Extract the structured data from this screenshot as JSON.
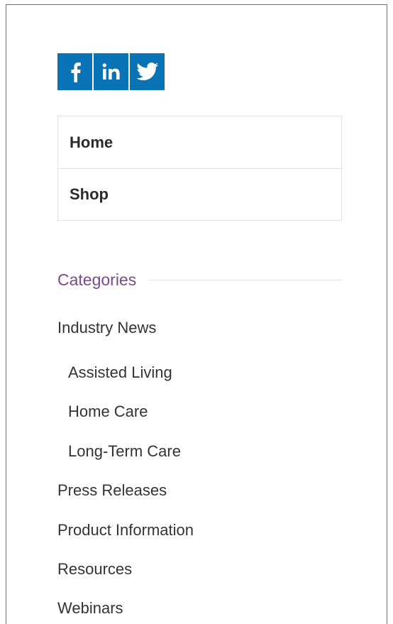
{
  "social": {
    "icons": [
      "facebook-icon",
      "linkedin-icon",
      "twitter-icon"
    ],
    "color": "#0a73b6"
  },
  "nav": {
    "items": [
      {
        "label": "Home"
      },
      {
        "label": "Shop"
      }
    ]
  },
  "categories": {
    "title": "Categories",
    "title_color": "#7a4a8a",
    "items": [
      {
        "label": "Industry News"
      },
      {
        "label": "Assisted Living"
      },
      {
        "label": "Home Care"
      },
      {
        "label": "Long-Term Care"
      },
      {
        "label": "Press Releases"
      },
      {
        "label": "Product Information"
      },
      {
        "label": "Resources"
      },
      {
        "label": "Webinars"
      }
    ]
  }
}
